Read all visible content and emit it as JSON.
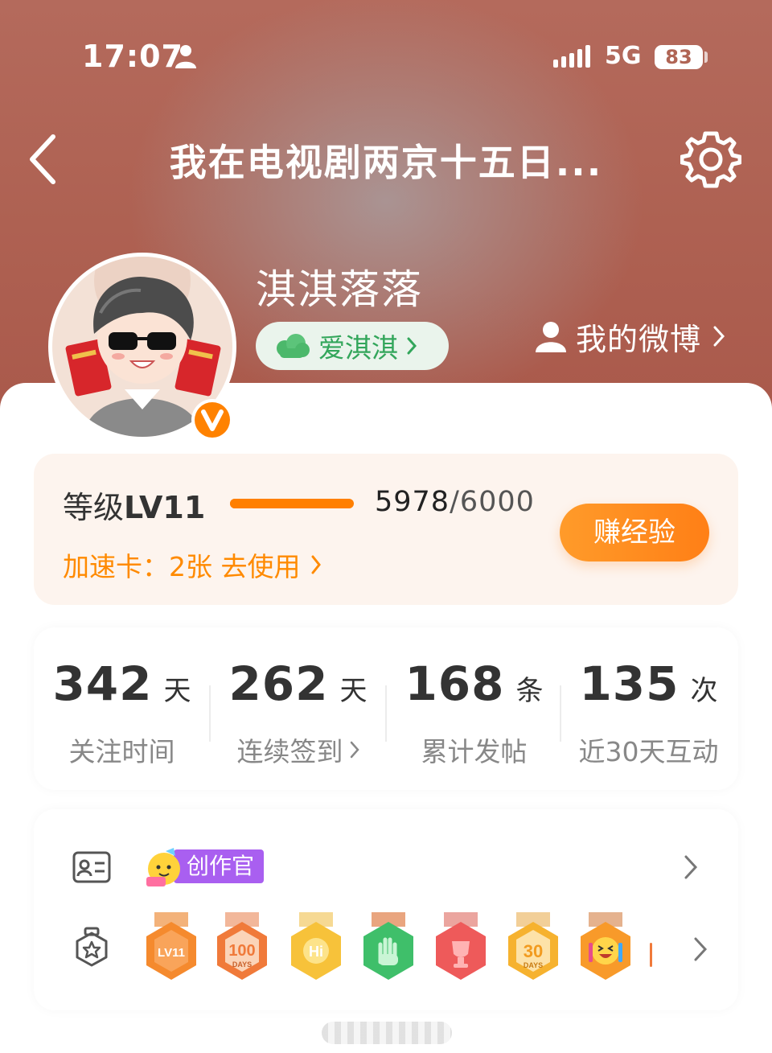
{
  "status_bar": {
    "time": "17:07",
    "network": "5G",
    "battery": "83"
  },
  "nav": {
    "title": "我在电视剧两京十五日..."
  },
  "profile": {
    "nickname": "淇淇落落",
    "fan_tag": "爱淇淇",
    "my_weibo": "我的微博"
  },
  "level": {
    "label_prefix": "等级",
    "level": "LV11",
    "current": "5978",
    "separator": "/",
    "max": "6000",
    "progress_fraction": 0.9963,
    "speed_card": "加速卡：2张 去使用",
    "earn_button": "赚经验"
  },
  "stats": [
    {
      "value": "342",
      "unit": "天",
      "caption": "关注时间",
      "has_arrow": false
    },
    {
      "value": "262",
      "unit": "天",
      "caption": "连续签到",
      "has_arrow": true
    },
    {
      "value": "168",
      "unit": "条",
      "caption": "累计发帖",
      "has_arrow": false
    },
    {
      "value": "135",
      "unit": "次",
      "caption": "近30天互动",
      "has_arrow": false
    }
  ],
  "badges": {
    "creator_label": "创作官",
    "medals": [
      {
        "icon": "lv11-medal-icon",
        "text": "LV11",
        "color": "#f58a2e"
      },
      {
        "icon": "100-days-medal-icon",
        "text": "100",
        "sub": "DAYS",
        "color": "#f07a3a"
      },
      {
        "icon": "hi-medal-icon",
        "text": "Hi",
        "color": "#f7c23a"
      },
      {
        "icon": "hand-medal-icon",
        "text": "",
        "color": "#3fbf6a"
      },
      {
        "icon": "trophy-medal-icon",
        "text": "",
        "color": "#ee5a5a"
      },
      {
        "icon": "30-days-medal-icon",
        "text": "30",
        "sub": "DAYS",
        "color": "#f6b22f"
      },
      {
        "icon": "laugh-emoji-medal-icon",
        "text": "",
        "color": "#f89a2a"
      }
    ]
  },
  "colors": {
    "accent_orange": "#ff7f00",
    "fan_green": "#33a65b",
    "creator_purple": "#a95ff0",
    "header_red": "#ae6152"
  }
}
